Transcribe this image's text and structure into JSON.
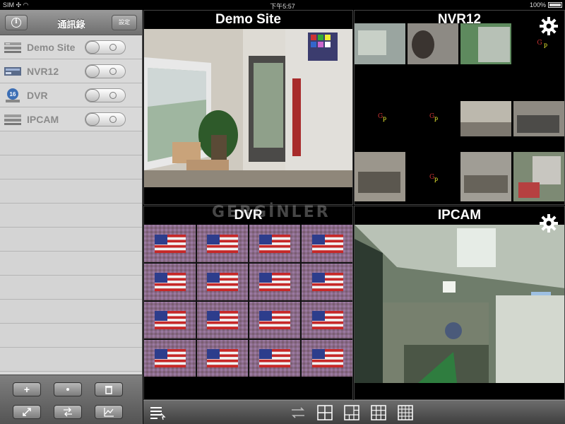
{
  "status_bar": {
    "carrier": "SIM",
    "time": "下午5:57",
    "battery": "100%"
  },
  "sidebar": {
    "title": "通訊錄",
    "setup_label": "設定",
    "devices": [
      {
        "name": "Demo Site",
        "icon": "dvr-device-icon",
        "enabled": false
      },
      {
        "name": "NVR12",
        "icon": "nvr-device-icon",
        "enabled": false
      },
      {
        "name": "DVR",
        "icon": "dvr16-device-icon",
        "enabled": false
      },
      {
        "name": "IPCAM",
        "icon": "ipcam-device-icon",
        "enabled": false
      }
    ],
    "footer_buttons": [
      {
        "label": "+",
        "icon": "add-icon"
      },
      {
        "label": "",
        "icon": "move-icon"
      },
      {
        "label": "",
        "icon": "delete-icon"
      },
      {
        "label": "",
        "icon": "expand-icon"
      },
      {
        "label": "",
        "icon": "swap-icon"
      },
      {
        "label": "",
        "icon": "chart-icon"
      }
    ]
  },
  "tiles": [
    {
      "title": "Demo Site",
      "layout": "single"
    },
    {
      "title": "NVR12",
      "layout": "grid-4x3",
      "has_settings": true
    },
    {
      "title": "DVR",
      "layout": "grid-4x4"
    },
    {
      "title": "IPCAM",
      "layout": "single",
      "has_settings": true
    }
  ],
  "bottom_toolbar": [
    {
      "icon": "device-list-icon"
    },
    {
      "icon": "rotate-icon"
    },
    {
      "icon": "layout-2x2-icon"
    },
    {
      "icon": "layout-1plus3-icon"
    },
    {
      "icon": "layout-3x3-icon"
    },
    {
      "icon": "layout-4x4-icon"
    }
  ],
  "watermark": "GERGİNLER"
}
